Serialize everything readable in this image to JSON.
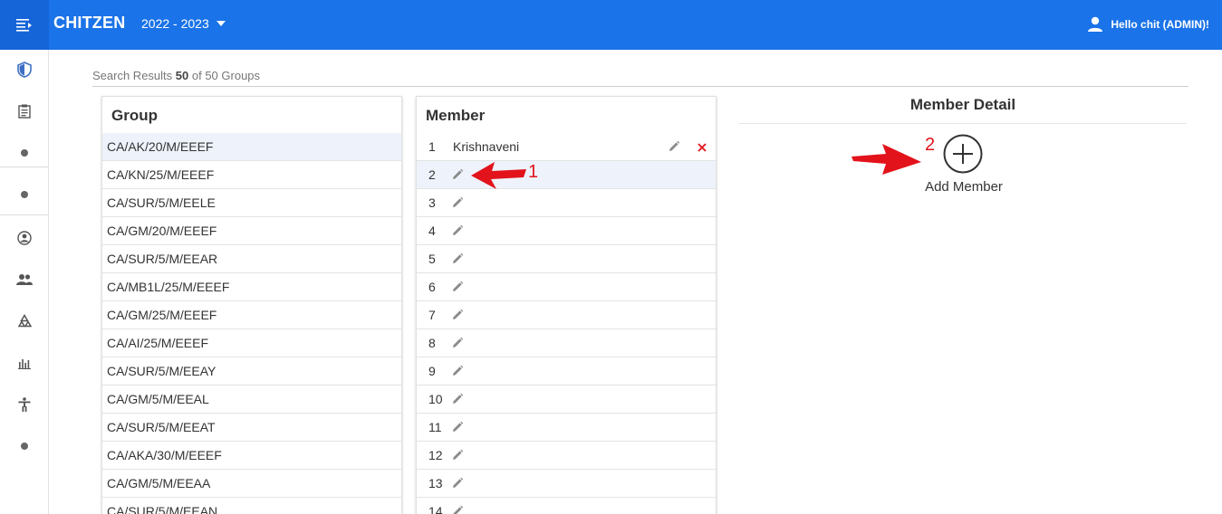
{
  "header": {
    "app_title": "CHITZEN",
    "year": "2022 - 2023",
    "user_greeting": "Hello chit (ADMIN)!"
  },
  "search": {
    "prefix": "Search Results",
    "count": "50",
    "suffix": "of 50 Groups"
  },
  "groups": {
    "title": "Group",
    "items": [
      "CA/AK/20/M/EEEF",
      "CA/KN/25/M/EEEF",
      "CA/SUR/5/M/EELE",
      "CA/GM/20/M/EEEF",
      "CA/SUR/5/M/EEAR",
      "CA/MB1L/25/M/EEEF",
      "CA/GM/25/M/EEEF",
      "CA/AI/25/M/EEEF",
      "CA/SUR/5/M/EEAY",
      "CA/GM/5/M/EEAL",
      "CA/SUR/5/M/EEAT",
      "CA/AKA/30/M/EEEF",
      "CA/GM/5/M/EEAA",
      "CA/SUR/5/M/EEAN"
    ]
  },
  "members": {
    "title": "Member",
    "rows": [
      {
        "num": "1",
        "name": "Krishnaveni"
      },
      {
        "num": "2",
        "name": ""
      },
      {
        "num": "3",
        "name": ""
      },
      {
        "num": "4",
        "name": ""
      },
      {
        "num": "5",
        "name": ""
      },
      {
        "num": "6",
        "name": ""
      },
      {
        "num": "7",
        "name": ""
      },
      {
        "num": "8",
        "name": ""
      },
      {
        "num": "9",
        "name": ""
      },
      {
        "num": "10",
        "name": ""
      },
      {
        "num": "11",
        "name": ""
      },
      {
        "num": "12",
        "name": ""
      },
      {
        "num": "13",
        "name": ""
      },
      {
        "num": "14",
        "name": ""
      }
    ]
  },
  "detail": {
    "title": "Member Detail",
    "add_label": "Add Member"
  },
  "annotations": {
    "one": "1",
    "two": "2"
  },
  "colors": {
    "primary": "#1a73e8",
    "annotation": "#e3131b",
    "selected_row": "#eef3fb"
  }
}
